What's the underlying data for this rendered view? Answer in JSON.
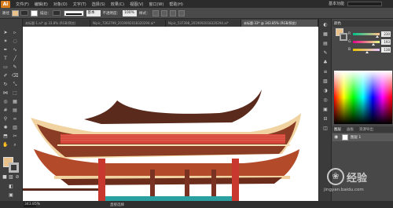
{
  "menubar": {
    "logo": "Ai",
    "items": [
      "文件(F)",
      "编辑(E)",
      "对象(O)",
      "文字(T)",
      "选择(S)",
      "效果(C)",
      "视图(V)",
      "窗口(W)",
      "帮助(H)"
    ],
    "workspace": "基本功能"
  },
  "options": {
    "selection_label": "路径",
    "stroke_label": "描边：",
    "stroke_weight": "基本",
    "opacity_label": "不透明度：",
    "opacity_value": "100%",
    "style_label": "样式：",
    "fill_color": "#e8c28a"
  },
  "tabs": [
    {
      "label": "未标题-1.ai* @ 33.8% (RGB/预览)"
    },
    {
      "label": "Nipic_7262799_2019092018320294.ai*"
    },
    {
      "label": "Nipic_537398_2019092018320294.ai*"
    },
    {
      "label": "未标题-33* @ 343.85% (RGB/预览)"
    }
  ],
  "color_panel": {
    "tab": "颜色",
    "channels": [
      {
        "name": "R",
        "value": "230",
        "level": 0.9
      },
      {
        "name": "G",
        "value": "193",
        "level": 0.76
      },
      {
        "name": "B",
        "value": "138",
        "level": 0.54
      }
    ]
  },
  "layers_panel": {
    "tabs": [
      "图层",
      "画板",
      "资源导出"
    ],
    "layer_name": "图层 1"
  },
  "status": {
    "zoom": "343.85%",
    "tool": "直接选择"
  },
  "watermark": {
    "name": "经验",
    "url": "jingyan.baidu.com"
  },
  "colors": {
    "roof_red": "#d6453a",
    "roof_dark": "#5a2a1c",
    "roof_cream": "#f0d3a0",
    "pillar": "#c8382e",
    "teal": "#2aa0a0"
  }
}
